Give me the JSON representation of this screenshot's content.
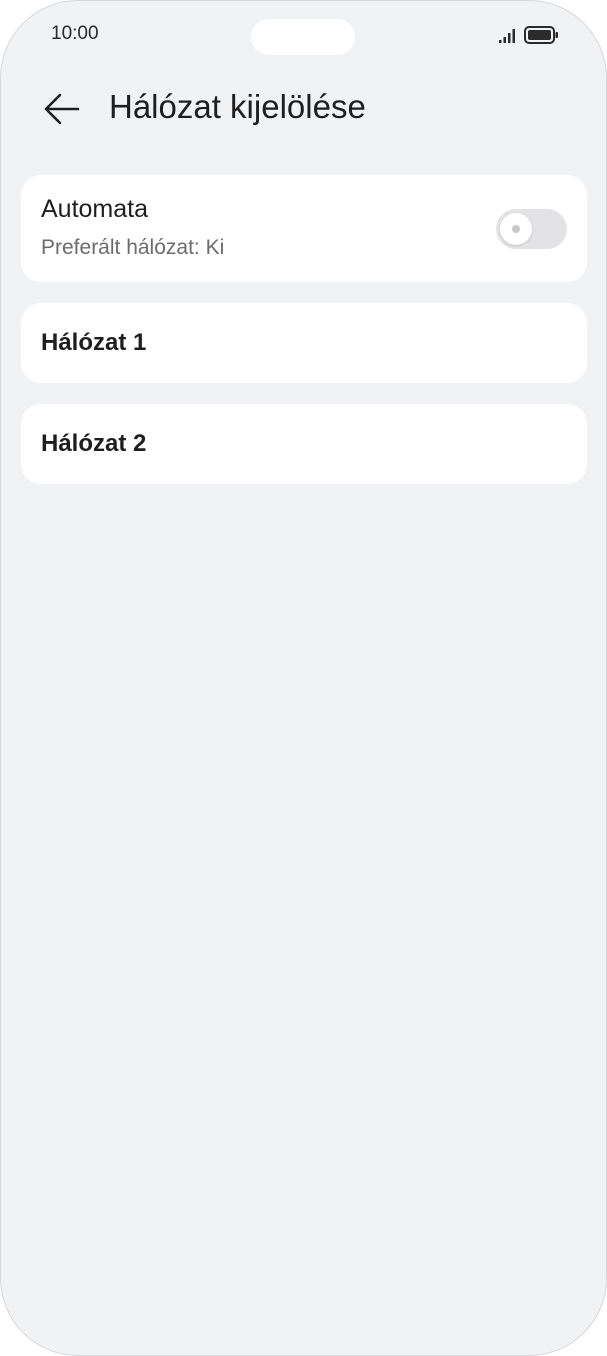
{
  "status_bar": {
    "time": "10:00",
    "signal_icon": "signal-icon",
    "battery_icon": "battery-icon"
  },
  "header": {
    "back_icon": "arrow-left-icon",
    "title": "Hálózat kijelölése"
  },
  "automatic": {
    "title": "Automata",
    "subtitle": "Preferált hálózat: Ki",
    "toggle_on": false
  },
  "networks": [
    {
      "label": "Hálózat 1"
    },
    {
      "label": "Hálózat 2"
    }
  ],
  "colors": {
    "background": "#f1f2f4",
    "card": "#ffffff",
    "text_primary": "#1e1e1e",
    "text_secondary": "#6c6c6c",
    "toggle_off": "#e3e3e5"
  }
}
